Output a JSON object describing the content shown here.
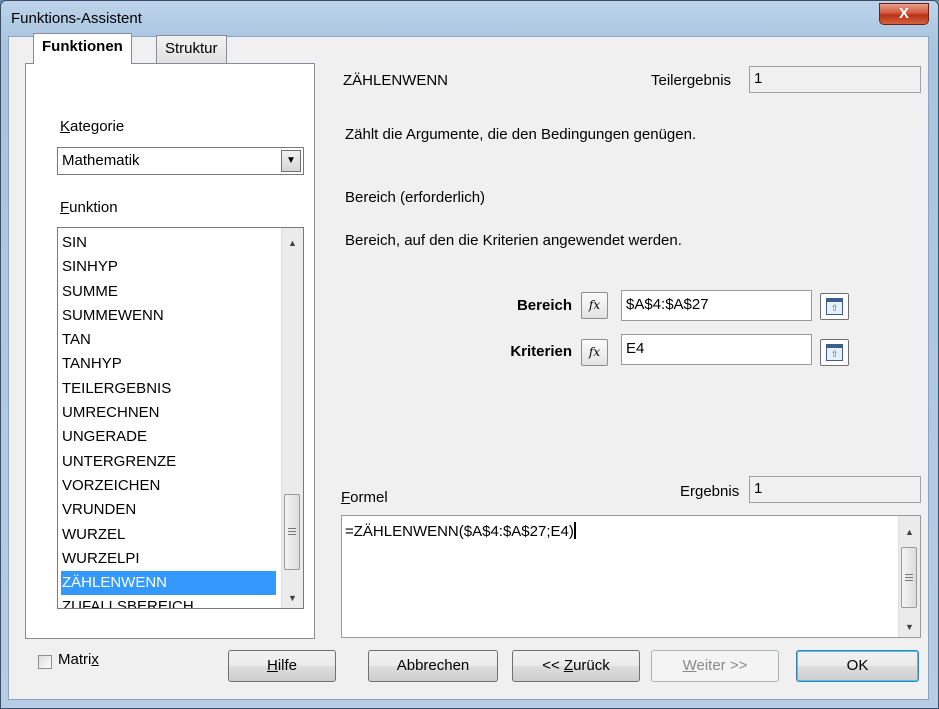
{
  "window": {
    "title": "Funktions-Assistent",
    "close_glyph": "X"
  },
  "tabs": {
    "functions": "Funktionen",
    "structure": "Struktur"
  },
  "category": {
    "label_first": "K",
    "label_rest": "ategorie",
    "value": "Mathematik"
  },
  "function_list": {
    "label_first": "F",
    "label_rest": "unktion",
    "items": [
      "SIN",
      "SINHYP",
      "SUMME",
      "SUMMEWENN",
      "TAN",
      "TANHYP",
      "TEILERGEBNIS",
      "UMRECHNEN",
      "UNGERADE",
      "UNTERGRENZE",
      "VORZEICHEN",
      "VRUNDEN",
      "WURZEL",
      "WURZELPI",
      "ZÄHLENWENN",
      "ZUFALLSBEREICH"
    ],
    "selected": "ZÄHLENWENN"
  },
  "function_info": {
    "name": "ZÄHLENWENN",
    "subtotal_label": "Teilergebnis",
    "subtotal_value": "1",
    "description": "Zählt die Argumente, die den Bedingungen genügen.",
    "arg_title": "Bereich (erforderlich)",
    "arg_description": "Bereich, auf den die Kriterien angewendet werden."
  },
  "arguments": [
    {
      "label": "Bereich",
      "value": "$A$4:$A$27",
      "fx": "fx"
    },
    {
      "label": "Kriterien",
      "value": "E4",
      "fx": "fx"
    }
  ],
  "formula": {
    "label_first": "F",
    "label_rest": "ormel",
    "result_label": "Ergebnis",
    "result_value": "1",
    "text": "=ZÄHLENWENN($A$4:$A$27;E4)"
  },
  "matrix": {
    "label_main": "Matri",
    "label_ul": "x",
    "checked": false
  },
  "buttons": {
    "help": {
      "ul": "H",
      "rest": "ilfe"
    },
    "cancel": "Abbrechen",
    "back": {
      "pre": "<< ",
      "ul": "Z",
      "rest": "urück"
    },
    "next": {
      "ul": "W",
      "rest": "eiter >>"
    },
    "ok": "OK"
  }
}
